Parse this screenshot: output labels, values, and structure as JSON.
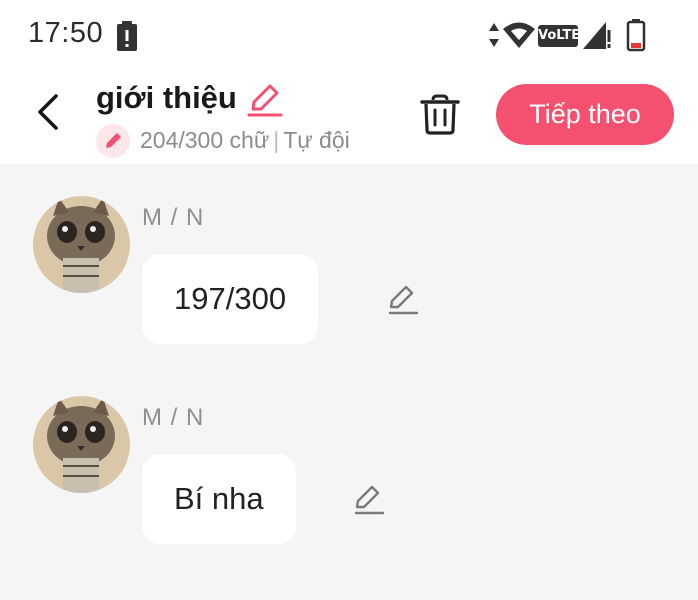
{
  "status_bar": {
    "time": "17:50",
    "network_label": "VoLTE",
    "icons": [
      "alert-icon",
      "data-arrows-icon",
      "wifi-icon",
      "volte-icon",
      "signal-icon",
      "battery-icon"
    ]
  },
  "header": {
    "title": "giới thiệu",
    "subtitle_count": "204/300 chữ",
    "subtitle_separator": "|",
    "subtitle_mode": "Tự đội",
    "next_button_label": "Tiếp theo"
  },
  "messages": [
    {
      "sender": "M / N",
      "text": "197/300"
    },
    {
      "sender": "M / N",
      "text": "Bí nha"
    }
  ],
  "colors": {
    "accent": "#f3516f",
    "accent_light": "#fde6ea",
    "background": "#f5f5f5",
    "bubble": "#ffffff"
  }
}
